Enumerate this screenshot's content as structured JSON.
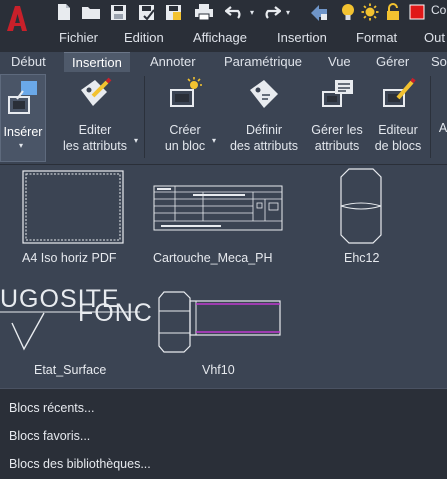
{
  "window": {
    "title_partial": "Co"
  },
  "menubar": {
    "items": [
      "Fichier",
      "Edition",
      "Affichage",
      "Insertion",
      "Format",
      "Out"
    ]
  },
  "ribbon_tabs": {
    "items": [
      "Début",
      "Insertion",
      "Annoter",
      "Paramétrique",
      "Vue",
      "Gérer",
      "Sor"
    ],
    "active": "Insertion"
  },
  "ribbon": {
    "insert": "Insérer",
    "edit_attributes": [
      "Editer",
      "les attributs"
    ],
    "create_block": [
      "Créer",
      "un bloc"
    ],
    "define_attributes": [
      "Définir",
      "des attributs"
    ],
    "manage_attributes": [
      "Gérer les",
      "attributs"
    ],
    "block_editor": [
      "Editeur",
      "de blocs"
    ],
    "cut_label": "A"
  },
  "blocks": {
    "a4": "A4 Iso horiz PDF",
    "cartouche": "Cartouche_Meca_PH",
    "ehc12": "Ehc12",
    "etat_surface": "Etat_Surface",
    "vhf10": "Vhf10",
    "etat_surface_text1": "UGOSITE",
    "etat_surface_text2": "FONC"
  },
  "bottom_menu": {
    "recent": "Blocs récents...",
    "favorites": "Blocs favoris...",
    "libraries": "Blocs des bibliothèques..."
  },
  "colors": {
    "app_red": "#c8202a",
    "accent_magenta": "#c03ad0",
    "qa_yellow": "#f2c230",
    "qa_red": "#e01818"
  }
}
